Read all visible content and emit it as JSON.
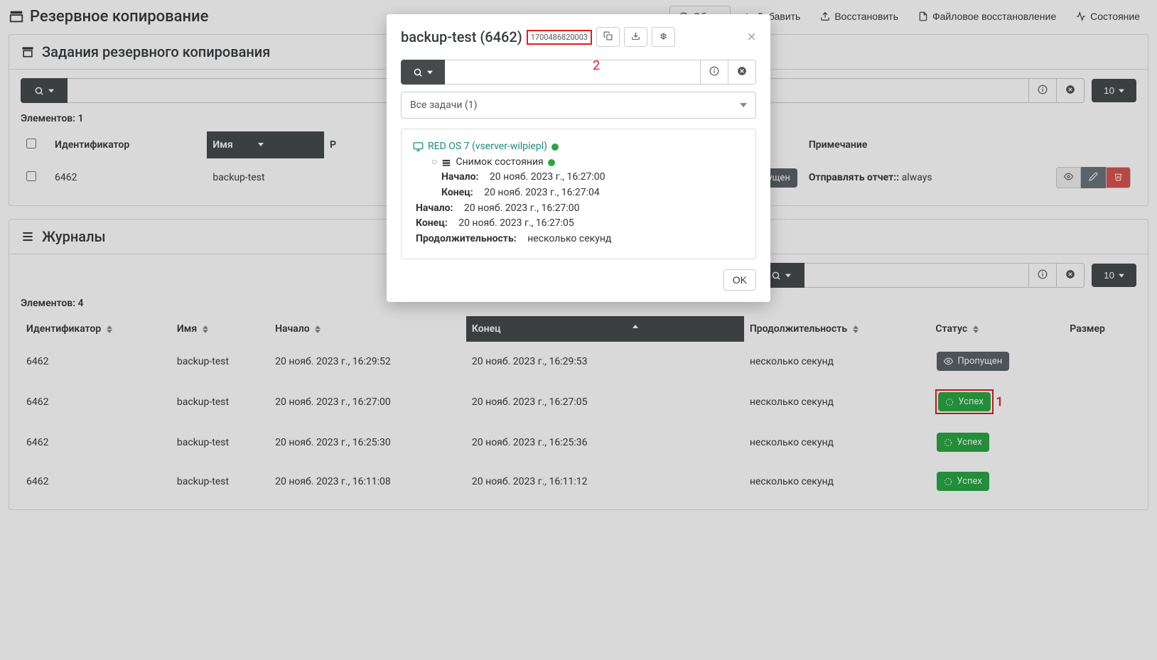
{
  "page": {
    "title": "Резервное копирование"
  },
  "topnav": {
    "overview": "Обзор",
    "add": "Добавить",
    "restore": "Восстановить",
    "file_restore": "Файловое восстановление",
    "status": "Состояние"
  },
  "jobs_panel": {
    "title": "Задания резервного копирования",
    "page_size": "10",
    "elements_label": "Элементов: 1",
    "columns": {
      "id": "Идентификатор",
      "name": "Имя",
      "r": "Р",
      "note": "Примечание"
    },
    "rows": [
      {
        "id": "6462",
        "name": "backup-test",
        "note_label": "Отправлять отчет::",
        "note_val": "always",
        "skip_label": "Пропущен"
      }
    ]
  },
  "logs_panel": {
    "title": "Журналы",
    "page_size": "10",
    "elements_label": "Элементов: 4",
    "columns": {
      "id": "Идентификатор",
      "name": "Имя",
      "start": "Начало",
      "end": "Конец",
      "duration": "Продолжительность",
      "status": "Статус",
      "size": "Размер"
    },
    "rows": [
      {
        "id": "6462",
        "name": "backup-test",
        "start": "20 нояб. 2023 г., 16:29:52",
        "end": "20 нояб. 2023 г., 16:29:53",
        "duration": "несколько секунд",
        "status": "skip",
        "status_label": "Пропущен"
      },
      {
        "id": "6462",
        "name": "backup-test",
        "start": "20 нояб. 2023 г., 16:27:00",
        "end": "20 нояб. 2023 г., 16:27:05",
        "duration": "несколько секунд",
        "status": "ok",
        "status_label": "Успех"
      },
      {
        "id": "6462",
        "name": "backup-test",
        "start": "20 нояб. 2023 г., 16:25:30",
        "end": "20 нояб. 2023 г., 16:25:36",
        "duration": "несколько секунд",
        "status": "ok",
        "status_label": "Успех"
      },
      {
        "id": "6462",
        "name": "backup-test",
        "start": "20 нояб. 2023 г., 16:11:08",
        "end": "20 нояб. 2023 г., 16:11:12",
        "duration": "несколько секунд",
        "status": "ok",
        "status_label": "Успех"
      }
    ]
  },
  "modal": {
    "title": "backup-test (6462)",
    "timestamp": "1700486820003",
    "select_label": "Все задачи (1)",
    "vm_name": "RED OS 7 (vserver-wilpiepl)",
    "snapshot_label": "Снимок состояния",
    "snap_start_label": "Начало:",
    "snap_start_val": "20 нояб. 2023 г., 16:27:00",
    "snap_end_label": "Конец:",
    "snap_end_val": "20 нояб. 2023 г., 16:27:04",
    "job_start_label": "Начало:",
    "job_start_val": "20 нояб. 2023 г., 16:27:00",
    "job_end_label": "Конец:",
    "job_end_val": "20 нояб. 2023 г., 16:27:05",
    "duration_label": "Продолжительность:",
    "duration_val": "несколько секунд",
    "ok_label": "OK"
  },
  "annotations": {
    "a1": "1",
    "a2": "2"
  }
}
